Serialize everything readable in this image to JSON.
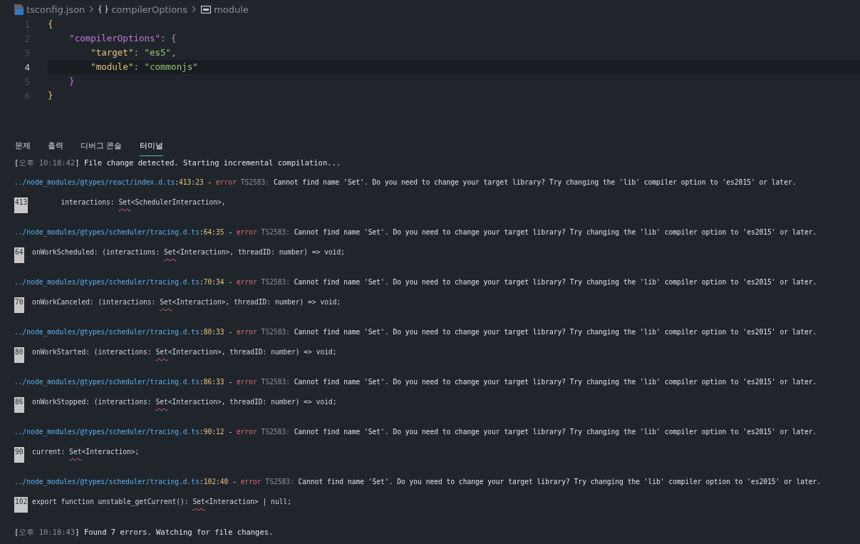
{
  "breadcrumb": [
    {
      "kind": "file",
      "label": "tsconfig.json"
    },
    {
      "kind": "object",
      "label": "compilerOptions"
    },
    {
      "kind": "string",
      "label": "module"
    }
  ],
  "editor": {
    "lines": [
      {
        "number": "1",
        "current": false,
        "tokens": [
          {
            "kind": "brace1",
            "text": "{"
          }
        ]
      },
      {
        "number": "2",
        "current": false,
        "tokens": [
          {
            "kind": "key",
            "text": "    \"compilerOptions\""
          },
          {
            "kind": "punct",
            "text": ": "
          },
          {
            "kind": "brace2",
            "text": "{"
          }
        ]
      },
      {
        "number": "3",
        "current": false,
        "tokens": [
          {
            "kind": "key2",
            "text": "        \"target\""
          },
          {
            "kind": "punct",
            "text": ": "
          },
          {
            "kind": "string",
            "text": "\"es5\""
          },
          {
            "kind": "punct",
            "text": ","
          }
        ]
      },
      {
        "number": "4",
        "current": true,
        "tokens": [
          {
            "kind": "key2",
            "text": "        \"module\""
          },
          {
            "kind": "punct",
            "text": ": "
          },
          {
            "kind": "string",
            "text": "\"commonjs\""
          }
        ]
      },
      {
        "number": "5",
        "current": false,
        "tokens": [
          {
            "kind": "brace2",
            "text": "    }"
          }
        ]
      },
      {
        "number": "6",
        "current": false,
        "tokens": [
          {
            "kind": "brace1",
            "text": "}"
          }
        ]
      }
    ]
  },
  "panel_tabs": [
    {
      "label": "문제",
      "selected": false
    },
    {
      "label": "출력",
      "selected": false
    },
    {
      "label": "디버그 콘솔",
      "selected": false
    },
    {
      "label": "터미널",
      "selected": true
    }
  ],
  "terminal": {
    "start": [
      {
        "kind": "plain",
        "text": "["
      },
      {
        "kind": "dim",
        "text": "오후 10:18:42"
      },
      {
        "kind": "plain",
        "text": "] File change detected. Starting incremental compilation..."
      }
    ],
    "errors": [
      {
        "header": [
          {
            "kind": "path",
            "text": "../node_modules/@types/react/index.d.ts"
          },
          {
            "kind": "plain",
            "text": ":"
          },
          {
            "kind": "num",
            "text": "413"
          },
          {
            "kind": "plain",
            "text": ":"
          },
          {
            "kind": "num",
            "text": "23"
          },
          {
            "kind": "plain",
            "text": " - "
          },
          {
            "kind": "error",
            "text": "error"
          },
          {
            "kind": "dim",
            "text": " TS2583:"
          },
          {
            "kind": "plain",
            "text": " Cannot find name 'Set'. Do you need to change your target library? Try changing the 'lib' compiler option to 'es2015' or later."
          }
        ],
        "source_number": "413",
        "before": "        interactions: ",
        "mark": "Set",
        "after": "<SchedulerInteraction>,"
      },
      {
        "header": [
          {
            "kind": "path",
            "text": "../node_modules/@types/scheduler/tracing.d.ts"
          },
          {
            "kind": "plain",
            "text": ":"
          },
          {
            "kind": "num",
            "text": "64"
          },
          {
            "kind": "plain",
            "text": ":"
          },
          {
            "kind": "num",
            "text": "35"
          },
          {
            "kind": "plain",
            "text": " - "
          },
          {
            "kind": "error",
            "text": "error"
          },
          {
            "kind": "dim",
            "text": " TS2583:"
          },
          {
            "kind": "plain",
            "text": " Cannot find name 'Set'. Do you need to change your target library? Try changing the 'lib' compiler option to 'es2015' or later."
          }
        ],
        "source_number": "64",
        "before": "  onWorkScheduled: (interactions: ",
        "mark": "Set",
        "after": "<Interaction>, threadID: number) => void;"
      },
      {
        "header": [
          {
            "kind": "path",
            "text": "../node_modules/@types/scheduler/tracing.d.ts"
          },
          {
            "kind": "plain",
            "text": ":"
          },
          {
            "kind": "num",
            "text": "70"
          },
          {
            "kind": "plain",
            "text": ":"
          },
          {
            "kind": "num",
            "text": "34"
          },
          {
            "kind": "plain",
            "text": " - "
          },
          {
            "kind": "error",
            "text": "error"
          },
          {
            "kind": "dim",
            "text": " TS2583:"
          },
          {
            "kind": "plain",
            "text": " Cannot find name 'Set'. Do you need to change your target library? Try changing the 'lib' compiler option to 'es2015' or later."
          }
        ],
        "source_number": "70",
        "before": "  onWorkCanceled: (interactions: ",
        "mark": "Set",
        "after": "<Interaction>, threadID: number) => void;"
      },
      {
        "header": [
          {
            "kind": "path",
            "text": "../node_modules/@types/scheduler/tracing.d.ts"
          },
          {
            "kind": "plain",
            "text": ":"
          },
          {
            "kind": "num",
            "text": "80"
          },
          {
            "kind": "plain",
            "text": ":"
          },
          {
            "kind": "num",
            "text": "33"
          },
          {
            "kind": "plain",
            "text": " - "
          },
          {
            "kind": "error",
            "text": "error"
          },
          {
            "kind": "dim",
            "text": " TS2583:"
          },
          {
            "kind": "plain",
            "text": " Cannot find name 'Set'. Do you need to change your target library? Try changing the 'lib' compiler option to 'es2015' or later."
          }
        ],
        "source_number": "80",
        "before": "  onWorkStarted: (interactions: ",
        "mark": "Set",
        "after": "<Interaction>, threadID: number) => void;"
      },
      {
        "header": [
          {
            "kind": "path",
            "text": "../node_modules/@types/scheduler/tracing.d.ts"
          },
          {
            "kind": "plain",
            "text": ":"
          },
          {
            "kind": "num",
            "text": "86"
          },
          {
            "kind": "plain",
            "text": ":"
          },
          {
            "kind": "num",
            "text": "33"
          },
          {
            "kind": "plain",
            "text": " - "
          },
          {
            "kind": "error",
            "text": "error"
          },
          {
            "kind": "dim",
            "text": " TS2583:"
          },
          {
            "kind": "plain",
            "text": " Cannot find name 'Set'. Do you need to change your target library? Try changing the 'lib' compiler option to 'es2015' or later."
          }
        ],
        "source_number": "86",
        "before": "  onWorkStopped: (interactions: ",
        "mark": "Set",
        "after": "<Interaction>, threadID: number) => void;"
      },
      {
        "header": [
          {
            "kind": "path",
            "text": "../node_modules/@types/scheduler/tracing.d.ts"
          },
          {
            "kind": "plain",
            "text": ":"
          },
          {
            "kind": "num",
            "text": "90"
          },
          {
            "kind": "plain",
            "text": ":"
          },
          {
            "kind": "num",
            "text": "12"
          },
          {
            "kind": "plain",
            "text": " - "
          },
          {
            "kind": "error",
            "text": "error"
          },
          {
            "kind": "dim",
            "text": " TS2583:"
          },
          {
            "kind": "plain",
            "text": " Cannot find name 'Set'. Do you need to change your target library? Try changing the 'lib' compiler option to 'es2015' or later."
          }
        ],
        "source_number": "90",
        "before": "  current: ",
        "mark": "Set",
        "after": "<Interaction>;"
      },
      {
        "header": [
          {
            "kind": "path",
            "text": "../node_modules/@types/scheduler/tracing.d.ts"
          },
          {
            "kind": "plain",
            "text": ":"
          },
          {
            "kind": "num",
            "text": "102"
          },
          {
            "kind": "plain",
            "text": ":"
          },
          {
            "kind": "num",
            "text": "40"
          },
          {
            "kind": "plain",
            "text": " - "
          },
          {
            "kind": "error",
            "text": "error"
          },
          {
            "kind": "dim",
            "text": " TS2583:"
          },
          {
            "kind": "plain",
            "text": " Cannot find name 'Set'. Do you need to change your target library? Try changing the 'lib' compiler option to 'es2015' or later."
          }
        ],
        "source_number": "102",
        "before": " export function unstable_getCurrent(): ",
        "mark": "Set",
        "after": "<Interaction> | null;"
      }
    ],
    "end": [
      {
        "kind": "plain",
        "text": "["
      },
      {
        "kind": "dim",
        "text": "오후 10:18:43"
      },
      {
        "kind": "plain",
        "text": "] Found 7 errors. Watching for file changes."
      }
    ]
  }
}
